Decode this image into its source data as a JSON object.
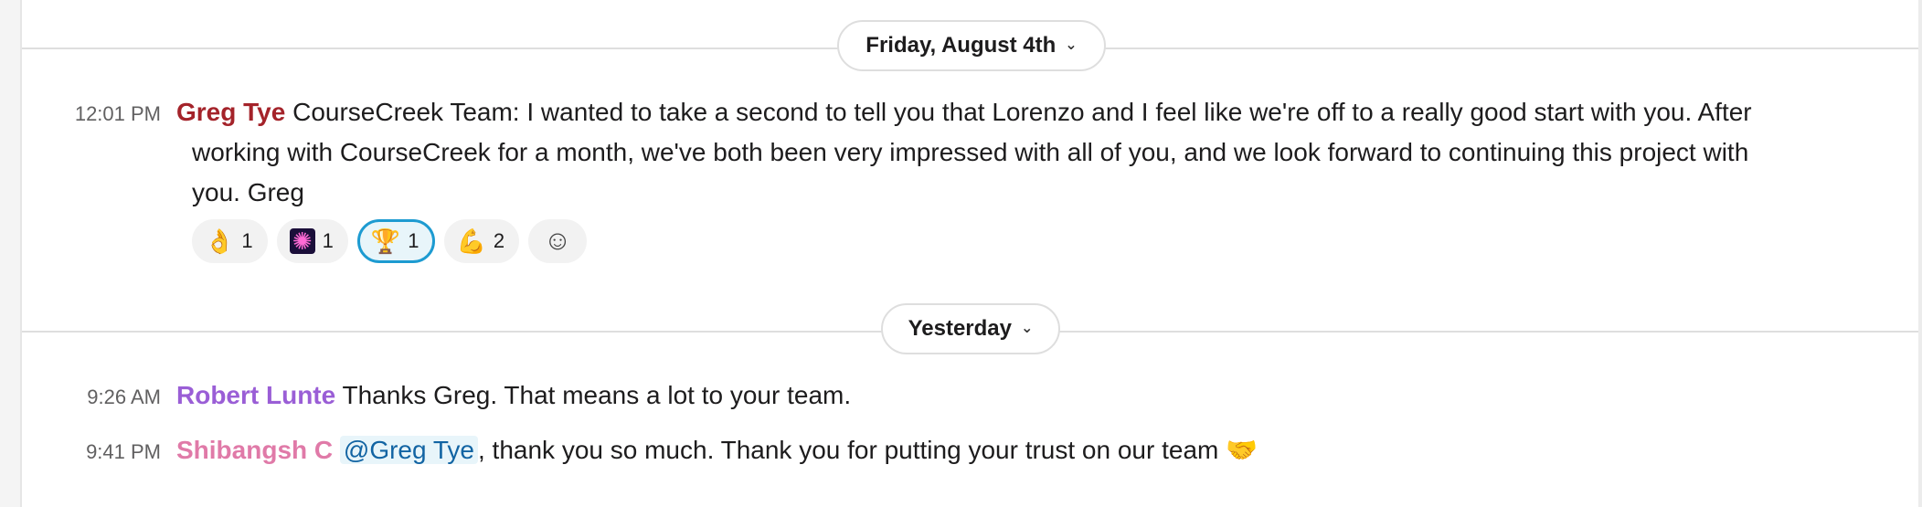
{
  "dividers": [
    {
      "label": "Friday, August 4th",
      "chevron": "⌄"
    },
    {
      "label": "Yesterday",
      "chevron": "⌄"
    }
  ],
  "messages": [
    {
      "time": "12:01 PM",
      "author": "Greg Tye",
      "lines": [
        " CourseCreek Team:  I wanted to take a second to tell you that Lorenzo and I feel like we're off to a really good start with you.  After",
        "working with CourseCreek for a month, we've both been very impressed with all of you, and we look forward to continuing this project with",
        "you.  Greg"
      ],
      "reactions": [
        {
          "emoji": "👌",
          "icon": "ok-hand-icon",
          "count": "1"
        },
        {
          "emoji": "🎇",
          "icon": "fireworks-icon",
          "count": "1"
        },
        {
          "emoji": "🏆",
          "icon": "trophy-icon",
          "count": "1",
          "active": true
        },
        {
          "emoji": "💪",
          "icon": "muscle-icon",
          "count": "2"
        }
      ],
      "add_reaction_icon": "☺"
    },
    {
      "time": "9:26 AM",
      "author": "Robert Lunte",
      "text": " Thanks Greg. That means a lot to your team."
    },
    {
      "time": "9:41 PM",
      "author": "Shibangsh C",
      "mention": "@Greg Tye",
      "text": ", thank you so much. Thank you for putting your trust on our team ",
      "trailing_emoji": "🤝"
    }
  ],
  "colors": {
    "greg": "#a4232a",
    "robert": "#9a5ed6",
    "shibangsh": "#e07aa8",
    "mention": "#1264a3",
    "reaction_active_border": "#1d9bd1"
  }
}
